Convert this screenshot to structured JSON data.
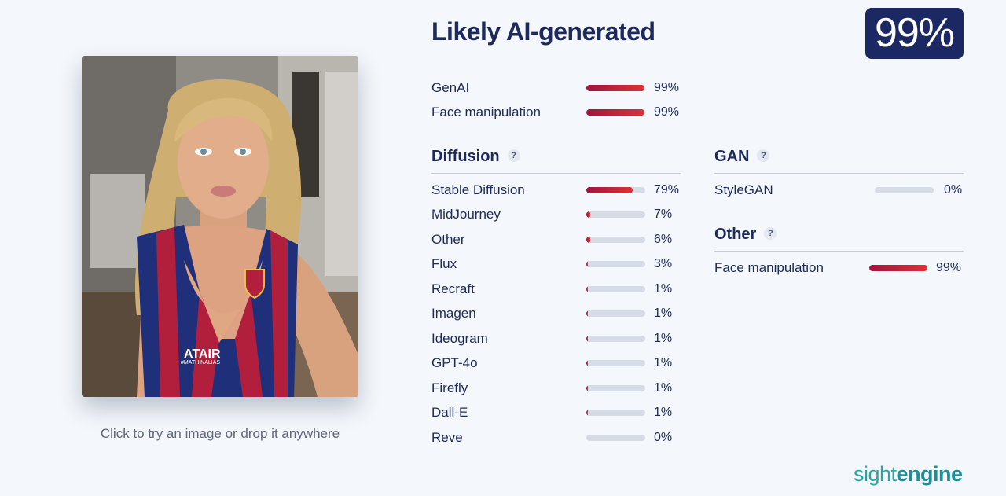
{
  "upload": {
    "caption": "Click to try an image or drop it anywhere",
    "jersey_text_1": "ATAIR",
    "jersey_text_2": "#MATHINALIAS"
  },
  "result": {
    "headline": "Likely AI-generated",
    "score": "99%"
  },
  "summary": [
    {
      "label": "GenAI",
      "value": 99,
      "pct": "99%"
    },
    {
      "label": "Face manipulation",
      "value": 99,
      "pct": "99%"
    }
  ],
  "diffusion": {
    "title": "Diffusion",
    "help": "?",
    "items": [
      {
        "label": "Stable Diffusion",
        "value": 79,
        "pct": "79%"
      },
      {
        "label": "MidJourney",
        "value": 7,
        "pct": "7%"
      },
      {
        "label": "Other",
        "value": 6,
        "pct": "6%"
      },
      {
        "label": "Flux",
        "value": 3,
        "pct": "3%"
      },
      {
        "label": "Recraft",
        "value": 1,
        "pct": "1%"
      },
      {
        "label": "Imagen",
        "value": 1,
        "pct": "1%"
      },
      {
        "label": "Ideogram",
        "value": 1,
        "pct": "1%"
      },
      {
        "label": "GPT-4o",
        "value": 1,
        "pct": "1%"
      },
      {
        "label": "Firefly",
        "value": 1,
        "pct": "1%"
      },
      {
        "label": "Dall-E",
        "value": 1,
        "pct": "1%"
      },
      {
        "label": "Reve",
        "value": 0,
        "pct": "0%"
      }
    ]
  },
  "gan": {
    "title": "GAN",
    "help": "?",
    "items": [
      {
        "label": "StyleGAN",
        "value": 0,
        "pct": "0%"
      }
    ]
  },
  "other": {
    "title": "Other",
    "help": "?",
    "items": [
      {
        "label": "Face manipulation",
        "value": 99,
        "pct": "99%"
      }
    ]
  },
  "brand": {
    "logo_part1": "sight",
    "logo_part2": "engine"
  },
  "colors": {
    "bar_start": "#a0153e",
    "bar_end": "#d9333a",
    "track": "#d6dce6",
    "badge_bg": "#1c2863",
    "text": "#1d2a5b"
  }
}
